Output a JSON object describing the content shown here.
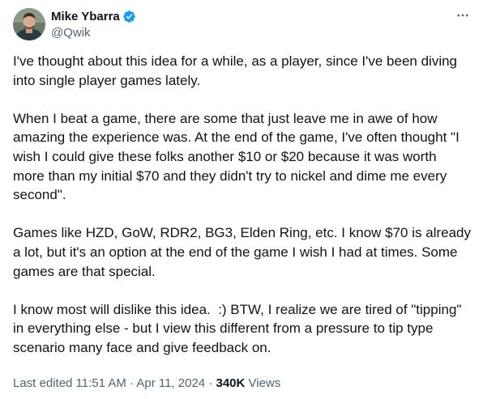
{
  "author": {
    "display_name": "Mike Ybarra",
    "handle": "@Qwik",
    "verified": true,
    "avatar_icon": "profile-photo"
  },
  "icons": {
    "verified": "verified-badge-icon",
    "more": "more-options-icon"
  },
  "colors": {
    "verified_blue": "#1d9bf0",
    "text_primary": "#0f1419",
    "text_secondary": "#536471"
  },
  "tweet": {
    "paragraphs": [
      "I've thought about this idea for a while, as a player, since I've been diving\ninto single player games lately.",
      "When I beat a game, there are some that just leave me in awe of how\namazing the experience was. At the end of the game, I've often thought \"I\nwish I could give these folks another $10 or $20 because it was worth\nmore than my initial $70 and they didn't try to nickel and dime me every\nsecond\".",
      "Games like HZD, GoW, RDR2, BG3, Elden Ring, etc. I know $70 is already\na lot, but it's an option at the end of the game I wish I had at times. Some\ngames are that special.",
      "I know most will dislike this idea.  :) BTW, I realize we are tired of \"tipping\"\nin everything else - but I view this different from a pressure to tip type\nscenario many face and give feedback on."
    ]
  },
  "meta": {
    "edited_label": "Last edited",
    "time": "11:51 AM",
    "separator": "·",
    "date": "Apr 11, 2024",
    "views_count": "340K",
    "views_label": "Views"
  }
}
